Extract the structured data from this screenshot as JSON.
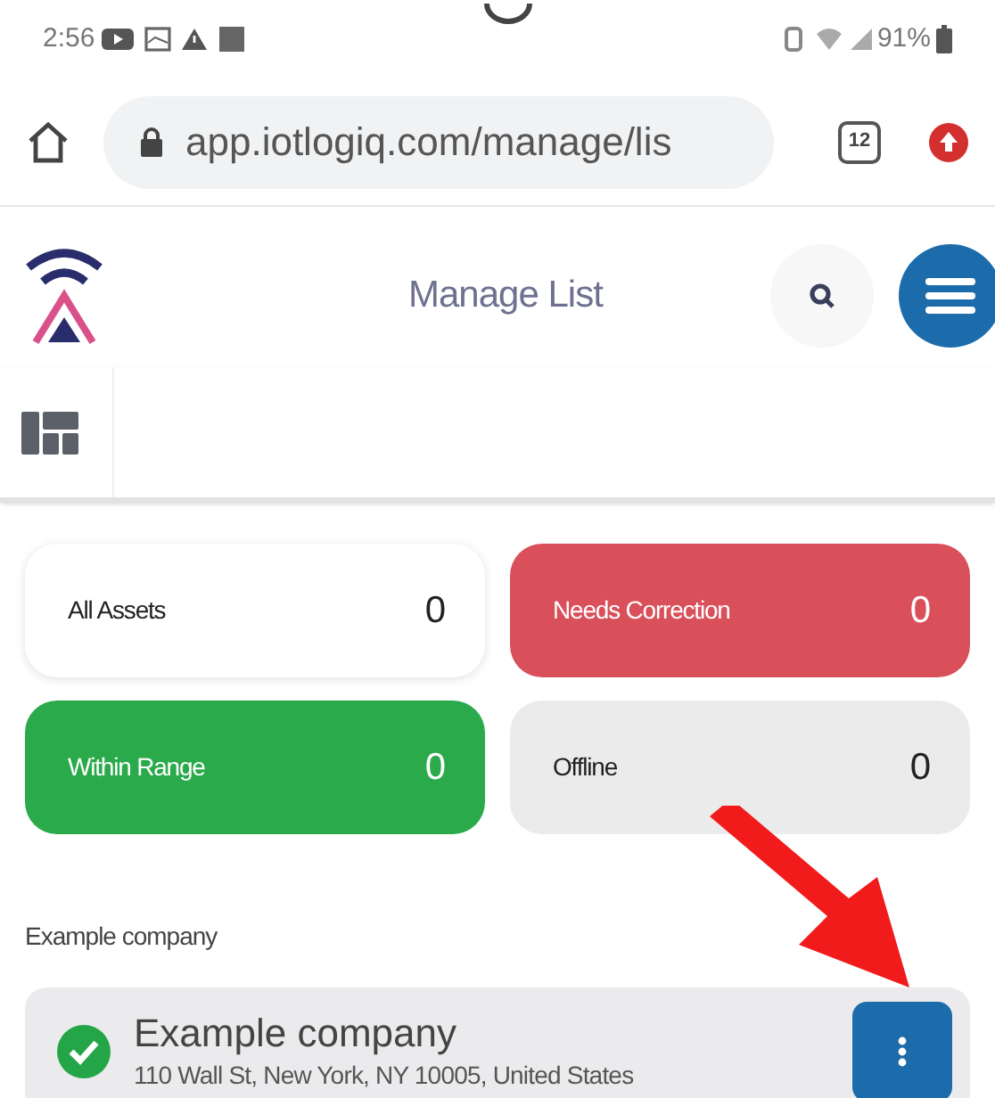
{
  "status_bar": {
    "time": "2:56",
    "battery": "91%"
  },
  "browser": {
    "url": "app.iotlogiq.com/manage/lis",
    "tab_count": "12"
  },
  "header": {
    "title": "Manage List"
  },
  "cards": [
    {
      "label": "All Assets",
      "count": "0",
      "color": "#ffffff",
      "kind": "plain"
    },
    {
      "label": "Needs Correction",
      "count": "0",
      "color": "#d9505b",
      "kind": "filled"
    },
    {
      "label": "Within Range",
      "count": "0",
      "color": "#2aaa4a",
      "kind": "filled"
    },
    {
      "label": "Offline",
      "count": "0",
      "color": "#ebebeb",
      "kind": "plain"
    }
  ],
  "group_label": "Example company",
  "items": [
    {
      "name": "Example company",
      "address": "110 Wall St, New York, NY 10005, United States",
      "verified": true
    }
  ]
}
